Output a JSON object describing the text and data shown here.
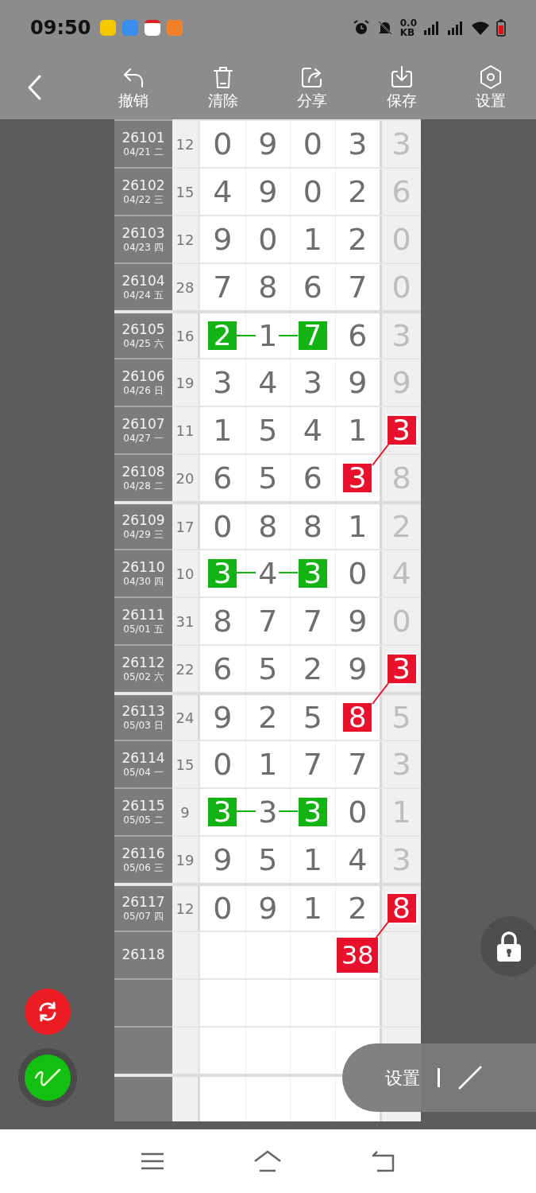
{
  "status_bar": {
    "time": "09:50",
    "net_speed": "0.0",
    "net_unit": "KB"
  },
  "toolbar": {
    "items": [
      {
        "kind": "undo",
        "label": "撤销"
      },
      {
        "kind": "clear",
        "label": "清除"
      },
      {
        "kind": "share",
        "label": "分享"
      },
      {
        "kind": "save",
        "label": "保存"
      },
      {
        "kind": "settings",
        "label": "设置"
      }
    ]
  },
  "table": {
    "groups": [
      {
        "rows": [
          {
            "kind": "draw",
            "issue": "26101",
            "date": "04/21 二",
            "sum": "12",
            "cells": [
              {
                "value": "0",
                "highlighted": false
              },
              {
                "value": "9",
                "highlighted": false
              },
              {
                "value": "0",
                "highlighted": false
              },
              {
                "value": "3",
                "highlighted": false
              },
              {
                "value": "3",
                "highlighted": false
              }
            ]
          },
          {
            "kind": "draw",
            "issue": "26102",
            "date": "04/22 三",
            "sum": "15",
            "cells": [
              {
                "value": "4",
                "highlighted": false
              },
              {
                "value": "9",
                "highlighted": false
              },
              {
                "value": "0",
                "highlighted": false
              },
              {
                "value": "2",
                "highlighted": false
              },
              {
                "value": "6",
                "highlighted": false
              }
            ]
          },
          {
            "kind": "draw",
            "issue": "26103",
            "date": "04/23 四",
            "sum": "12",
            "cells": [
              {
                "value": "9",
                "highlighted": false
              },
              {
                "value": "0",
                "highlighted": false
              },
              {
                "value": "1",
                "highlighted": false
              },
              {
                "value": "2",
                "highlighted": false
              },
              {
                "value": "0",
                "highlighted": false
              }
            ]
          },
          {
            "kind": "draw",
            "issue": "26104",
            "date": "04/24 五",
            "sum": "28",
            "cells": [
              {
                "value": "7",
                "highlighted": false
              },
              {
                "value": "8",
                "highlighted": false
              },
              {
                "value": "6",
                "highlighted": false
              },
              {
                "value": "7",
                "highlighted": false
              },
              {
                "value": "0",
                "highlighted": false
              }
            ]
          }
        ]
      },
      {
        "rows": [
          {
            "kind": "draw",
            "issue": "26105",
            "date": "04/25 六",
            "sum": "16",
            "green_link": true,
            "cells": [
              {
                "value": "2",
                "highlighted": true,
                "color": "#12b312"
              },
              {
                "value": "1",
                "highlighted": false
              },
              {
                "value": "7",
                "highlighted": true,
                "color": "#12b312"
              },
              {
                "value": "6",
                "highlighted": false
              },
              {
                "value": "3",
                "highlighted": false
              }
            ]
          },
          {
            "kind": "draw",
            "issue": "26106",
            "date": "04/26 日",
            "sum": "19",
            "cells": [
              {
                "value": "3",
                "highlighted": false
              },
              {
                "value": "4",
                "highlighted": false
              },
              {
                "value": "3",
                "highlighted": false
              },
              {
                "value": "9",
                "highlighted": false
              },
              {
                "value": "9",
                "highlighted": false
              }
            ]
          },
          {
            "kind": "draw",
            "issue": "26107",
            "date": "04/27 一",
            "sum": "11",
            "cells": [
              {
                "value": "1",
                "highlighted": false
              },
              {
                "value": "5",
                "highlighted": false
              },
              {
                "value": "4",
                "highlighted": false
              },
              {
                "value": "1",
                "highlighted": false
              },
              {
                "value": "3",
                "highlighted": true,
                "color": "#e8102a",
                "link": true
              }
            ]
          },
          {
            "kind": "draw",
            "issue": "26108",
            "date": "04/28 二",
            "sum": "20",
            "cells": [
              {
                "value": "6",
                "highlighted": false
              },
              {
                "value": "5",
                "highlighted": false
              },
              {
                "value": "6",
                "highlighted": false
              },
              {
                "value": "3",
                "highlighted": true,
                "color": "#e8102a"
              },
              {
                "value": "8",
                "highlighted": false
              }
            ]
          }
        ]
      },
      {
        "rows": [
          {
            "kind": "draw",
            "issue": "26109",
            "date": "04/29 三",
            "sum": "17",
            "cells": [
              {
                "value": "0",
                "highlighted": false
              },
              {
                "value": "8",
                "highlighted": false
              },
              {
                "value": "8",
                "highlighted": false
              },
              {
                "value": "1",
                "highlighted": false
              },
              {
                "value": "2",
                "highlighted": false
              }
            ]
          },
          {
            "kind": "draw",
            "issue": "26110",
            "date": "04/30 四",
            "sum": "10",
            "green_link": true,
            "cells": [
              {
                "value": "3",
                "highlighted": true,
                "color": "#12b312"
              },
              {
                "value": "4",
                "highlighted": false
              },
              {
                "value": "3",
                "highlighted": true,
                "color": "#12b312"
              },
              {
                "value": "0",
                "highlighted": false
              },
              {
                "value": "4",
                "highlighted": false
              }
            ]
          },
          {
            "kind": "draw",
            "issue": "26111",
            "date": "05/01 五",
            "sum": "31",
            "cells": [
              {
                "value": "8",
                "highlighted": false
              },
              {
                "value": "7",
                "highlighted": false
              },
              {
                "value": "7",
                "highlighted": false
              },
              {
                "value": "9",
                "highlighted": false
              },
              {
                "value": "0",
                "highlighted": false
              }
            ]
          },
          {
            "kind": "draw",
            "issue": "26112",
            "date": "05/02 六",
            "sum": "22",
            "cells": [
              {
                "value": "6",
                "highlighted": false
              },
              {
                "value": "5",
                "highlighted": false
              },
              {
                "value": "2",
                "highlighted": false
              },
              {
                "value": "9",
                "highlighted": false
              },
              {
                "value": "3",
                "highlighted": true,
                "color": "#e8102a",
                "link": true
              }
            ]
          }
        ]
      },
      {
        "rows": [
          {
            "kind": "draw",
            "issue": "26113",
            "date": "05/03 日",
            "sum": "24",
            "cells": [
              {
                "value": "9",
                "highlighted": false
              },
              {
                "value": "2",
                "highlighted": false
              },
              {
                "value": "5",
                "highlighted": false
              },
              {
                "value": "8",
                "highlighted": true,
                "color": "#e8102a"
              },
              {
                "value": "5",
                "highlighted": false
              }
            ]
          },
          {
            "kind": "draw",
            "issue": "26114",
            "date": "05/04 一",
            "sum": "15",
            "cells": [
              {
                "value": "0",
                "highlighted": false
              },
              {
                "value": "1",
                "highlighted": false
              },
              {
                "value": "7",
                "highlighted": false
              },
              {
                "value": "7",
                "highlighted": false
              },
              {
                "value": "3",
                "highlighted": false
              }
            ]
          },
          {
            "kind": "draw",
            "issue": "26115",
            "date": "05/05 二",
            "sum": "9",
            "green_link": true,
            "cells": [
              {
                "value": "3",
                "highlighted": true,
                "color": "#12b312"
              },
              {
                "value": "3",
                "highlighted": false
              },
              {
                "value": "3",
                "highlighted": true,
                "color": "#12b312"
              },
              {
                "value": "0",
                "highlighted": false
              },
              {
                "value": "1",
                "highlighted": false
              }
            ]
          },
          {
            "kind": "draw",
            "issue": "26116",
            "date": "05/06 三",
            "sum": "19",
            "cells": [
              {
                "value": "9",
                "highlighted": false
              },
              {
                "value": "5",
                "highlighted": false
              },
              {
                "value": "1",
                "highlighted": false
              },
              {
                "value": "4",
                "highlighted": false
              },
              {
                "value": "3",
                "highlighted": false
              }
            ]
          }
        ]
      },
      {
        "rows": [
          {
            "kind": "draw",
            "issue": "26117",
            "date": "05/07 四",
            "sum": "12",
            "cells": [
              {
                "value": "0",
                "highlighted": false
              },
              {
                "value": "9",
                "highlighted": false
              },
              {
                "value": "1",
                "highlighted": false
              },
              {
                "value": "2",
                "highlighted": false
              },
              {
                "value": "8",
                "highlighted": true,
                "color": "#e8102a",
                "link": true
              }
            ]
          },
          {
            "kind": "draw",
            "issue": "26118",
            "cells": [
              {
                "highlighted": false
              },
              {
                "highlighted": false
              },
              {
                "highlighted": false
              },
              {
                "value": "38",
                "highlighted": true,
                "color": "#e8102a"
              },
              {
                "highlighted": false
              }
            ]
          },
          {
            "kind": "empty"
          },
          {
            "kind": "empty"
          }
        ]
      },
      {
        "rows": [
          {
            "kind": "empty"
          }
        ]
      }
    ]
  },
  "float_menu": {
    "label": "设置"
  }
}
